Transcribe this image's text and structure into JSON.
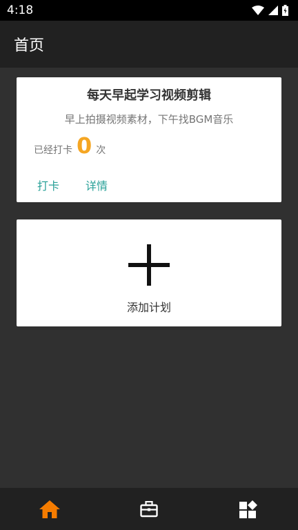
{
  "status_bar": {
    "time": "4:18",
    "icons": [
      "wifi-icon",
      "signal-icon",
      "battery-icon"
    ]
  },
  "app_bar": {
    "title": "首页"
  },
  "plan_card": {
    "title": "每天早起学习视频剪辑",
    "description": "早上拍摄视频素材，下午找BGM音乐",
    "checkin_label": "已经打卡",
    "checkin_count": "0",
    "checkin_unit": "次",
    "checkin_button": "打卡",
    "details_button": "详情"
  },
  "add_plan": {
    "icon": "plus-icon",
    "label": "添加计划"
  },
  "bottom_nav": {
    "items": [
      {
        "icon": "home-icon",
        "active": true
      },
      {
        "icon": "briefcase-icon",
        "active": false
      },
      {
        "icon": "widgets-icon",
        "active": false
      }
    ]
  },
  "colors": {
    "background": "#303030",
    "app_bar": "#212121",
    "accent_orange": "#F5A623",
    "link_teal": "#2aa198",
    "active_nav": "#F57C00"
  }
}
